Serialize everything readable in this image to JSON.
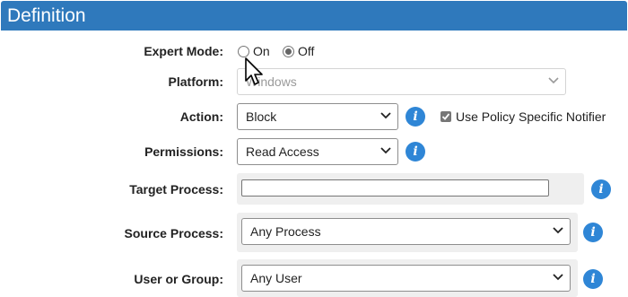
{
  "header": {
    "title": "Definition"
  },
  "expert_mode": {
    "label": "Expert Mode:",
    "options": [
      {
        "label": "On",
        "checked": false
      },
      {
        "label": "Off",
        "checked": true
      }
    ]
  },
  "platform": {
    "label": "Platform:",
    "value": "Windows",
    "disabled": true
  },
  "action": {
    "label": "Action:",
    "value": "Block"
  },
  "policy_notifier": {
    "label": "Use Policy Specific Notifier",
    "checked": true
  },
  "permissions": {
    "label": "Permissions:",
    "value": "Read Access"
  },
  "target_process": {
    "label": "Target Process:",
    "value": ""
  },
  "source_process": {
    "label": "Source Process:",
    "value": "Any Process"
  },
  "user_or_group": {
    "label": "User or Group:",
    "value": "Any User"
  },
  "info_glyph": "i",
  "colors": {
    "header": "#2f79bc",
    "info": "#2f86d6",
    "panel": "#efefef"
  }
}
